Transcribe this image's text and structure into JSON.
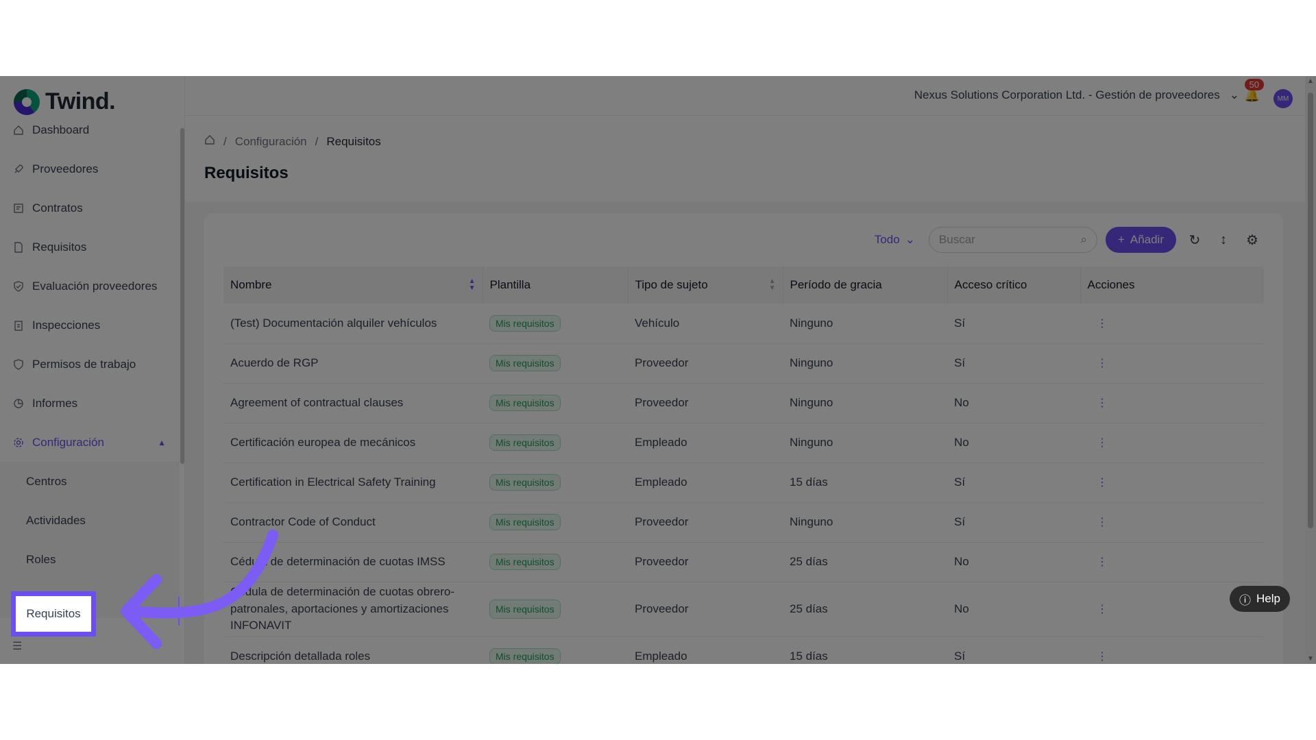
{
  "app": {
    "logo_text": "Twind."
  },
  "sidebar": {
    "items": [
      {
        "label": "Dashboard",
        "icon": "home-icon"
      },
      {
        "label": "Proveedores",
        "icon": "rocket-icon"
      },
      {
        "label": "Contratos",
        "icon": "contract-icon"
      },
      {
        "label": "Requisitos",
        "icon": "document-icon"
      },
      {
        "label": "Evaluación proveedores",
        "icon": "shield-check-icon"
      },
      {
        "label": "Inspecciones",
        "icon": "clipboard-icon"
      },
      {
        "label": "Permisos de trabajo",
        "icon": "shield-icon"
      },
      {
        "label": "Informes",
        "icon": "pie-chart-icon"
      },
      {
        "label": "Configuración",
        "icon": "gear-icon"
      }
    ],
    "sub_items": [
      "Centros",
      "Actividades",
      "Roles",
      "Requisitos"
    ]
  },
  "topbar": {
    "org": "Nexus Solutions Corporation Ltd. - Gestión de proveedores",
    "notifications": "50",
    "avatar": "MM"
  },
  "breadcrumb": {
    "level1": "Configuración",
    "level2": "Requisitos"
  },
  "page_title": "Requisitos",
  "toolbar": {
    "filter": "Todo",
    "search_placeholder": "Buscar",
    "add_label": "Añadir"
  },
  "table": {
    "headers": [
      "Nombre",
      "Plantilla",
      "Tipo de sujeto",
      "Período de gracia",
      "Acceso crítico",
      "Acciones"
    ],
    "rows": [
      {
        "nombre": "(Test) Documentación alquiler vehículos",
        "plantilla": "Mis requisitos",
        "tipo": "Vehículo",
        "gracia": "Ninguno",
        "critico": "Sí"
      },
      {
        "nombre": "Acuerdo de RGP",
        "plantilla": "Mis requisitos",
        "tipo": "Proveedor",
        "gracia": "Ninguno",
        "critico": "Sí"
      },
      {
        "nombre": "Agreement of contractual clauses",
        "plantilla": "Mis requisitos",
        "tipo": "Proveedor",
        "gracia": "Ninguno",
        "critico": "No"
      },
      {
        "nombre": "Certificación europea de mecánicos",
        "plantilla": "Mis requisitos",
        "tipo": "Empleado",
        "gracia": "Ninguno",
        "critico": "No"
      },
      {
        "nombre": "Certification in Electrical Safety Training",
        "plantilla": "Mis requisitos",
        "tipo": "Empleado",
        "gracia": "15 días",
        "critico": "Sí"
      },
      {
        "nombre": "Contractor Code of Conduct",
        "plantilla": "Mis requisitos",
        "tipo": "Proveedor",
        "gracia": "Ninguno",
        "critico": "Sí"
      },
      {
        "nombre": "Cédula de determinación de cuotas IMSS",
        "plantilla": "Mis requisitos",
        "tipo": "Proveedor",
        "gracia": "25 días",
        "critico": "No"
      },
      {
        "nombre": "Cédula de determinación de cuotas obrero-patronales, aportaciones y amortizaciones INFONAVIT",
        "plantilla": "Mis requisitos",
        "tipo": "Proveedor",
        "gracia": "25 días",
        "critico": "No"
      },
      {
        "nombre": "Descripción detallada roles",
        "plantilla": "Mis requisitos",
        "tipo": "Empleado",
        "gracia": "15 días",
        "critico": "Sí"
      }
    ]
  },
  "help_label": "Help",
  "colors": {
    "accent": "#6d4ef0",
    "badge_text": "#1f9d55",
    "notif": "#e53935"
  }
}
